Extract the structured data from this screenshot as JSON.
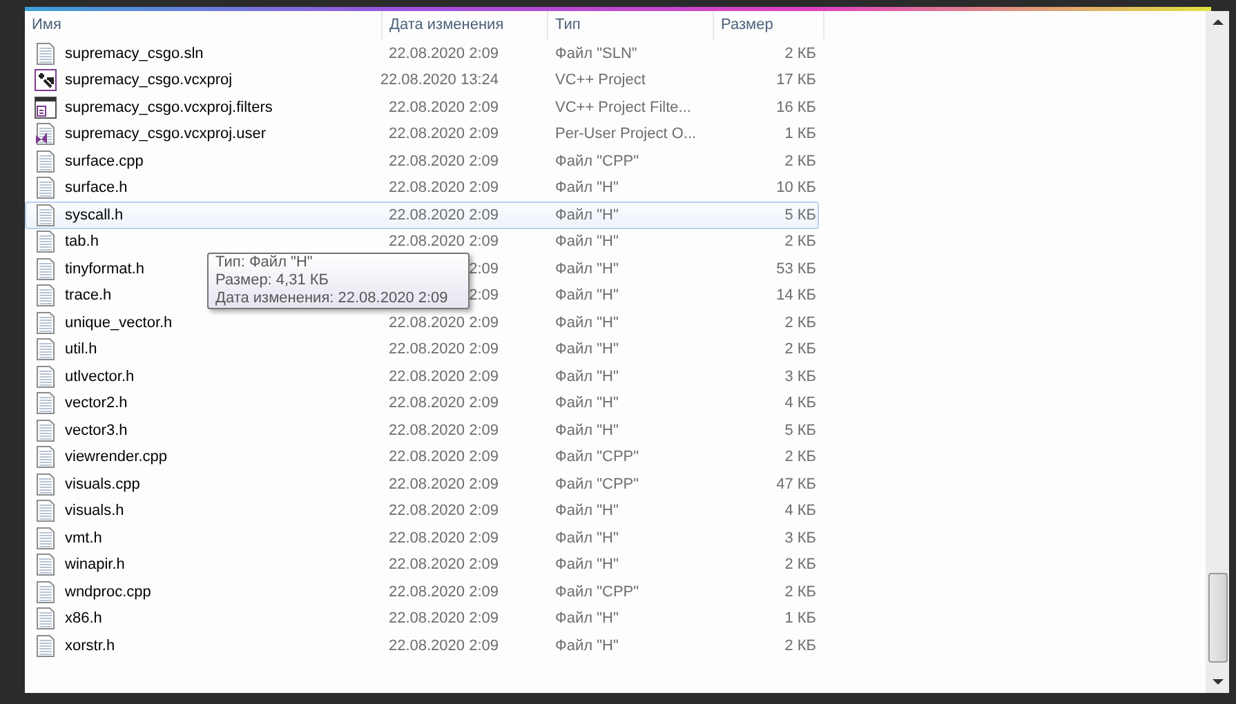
{
  "columns": [
    "Имя",
    "Дата изменения",
    "Тип",
    "Размер"
  ],
  "rows": [
    {
      "kind": "generic",
      "name": "supremacy_csgo.sln",
      "date": "22.08.2020 2:09",
      "type": "Файл \"SLN\"",
      "size": "2 КБ",
      "selected": false
    },
    {
      "kind": "project",
      "name": "supremacy_csgo.vcxproj",
      "date": "22.08.2020 13:24",
      "type": "VC++ Project",
      "size": "17 КБ",
      "selected": false
    },
    {
      "kind": "filters",
      "name": "supremacy_csgo.vcxproj.filters",
      "date": "22.08.2020 2:09",
      "type": "VC++ Project Filte...",
      "size": "16 КБ",
      "selected": false
    },
    {
      "kind": "user",
      "name": "supremacy_csgo.vcxproj.user",
      "date": "22.08.2020 2:09",
      "type": "Per-User Project O...",
      "size": "1 КБ",
      "selected": false
    },
    {
      "kind": "text",
      "name": "surface.cpp",
      "date": "22.08.2020 2:09",
      "type": "Файл \"CPP\"",
      "size": "2 КБ",
      "selected": false
    },
    {
      "kind": "text",
      "name": "surface.h",
      "date": "22.08.2020 2:09",
      "type": "Файл \"H\"",
      "size": "10 КБ",
      "selected": false
    },
    {
      "kind": "text",
      "name": "syscall.h",
      "date": "22.08.2020 2:09",
      "type": "Файл \"H\"",
      "size": "5 КБ",
      "selected": true
    },
    {
      "kind": "text",
      "name": "tab.h",
      "date": "22.08.2020 2:09",
      "type": "Файл \"H\"",
      "size": "2 КБ",
      "selected": false
    },
    {
      "kind": "text",
      "name": "tinyformat.h",
      "date": "2:09",
      "type": "Файл \"H\"",
      "size": "53 КБ",
      "selected": false
    },
    {
      "kind": "text",
      "name": "trace.h",
      "date": "2:09",
      "type": "Файл \"H\"",
      "size": "14 КБ",
      "selected": false
    },
    {
      "kind": "text",
      "name": "unique_vector.h",
      "date": "22.08.2020 2:09",
      "type": "Файл \"H\"",
      "size": "2 КБ",
      "selected": false
    },
    {
      "kind": "text",
      "name": "util.h",
      "date": "22.08.2020 2:09",
      "type": "Файл \"H\"",
      "size": "2 КБ",
      "selected": false
    },
    {
      "kind": "text",
      "name": "utlvector.h",
      "date": "22.08.2020 2:09",
      "type": "Файл \"H\"",
      "size": "3 КБ",
      "selected": false
    },
    {
      "kind": "text",
      "name": "vector2.h",
      "date": "22.08.2020 2:09",
      "type": "Файл \"H\"",
      "size": "4 КБ",
      "selected": false
    },
    {
      "kind": "text",
      "name": "vector3.h",
      "date": "22.08.2020 2:09",
      "type": "Файл \"H\"",
      "size": "5 КБ",
      "selected": false
    },
    {
      "kind": "text",
      "name": "viewrender.cpp",
      "date": "22.08.2020 2:09",
      "type": "Файл \"CPP\"",
      "size": "2 КБ",
      "selected": false
    },
    {
      "kind": "text",
      "name": "visuals.cpp",
      "date": "22.08.2020 2:09",
      "type": "Файл \"CPP\"",
      "size": "47 КБ",
      "selected": false
    },
    {
      "kind": "text",
      "name": "visuals.h",
      "date": "22.08.2020 2:09",
      "type": "Файл \"H\"",
      "size": "4 КБ",
      "selected": false
    },
    {
      "kind": "text",
      "name": "vmt.h",
      "date": "22.08.2020 2:09",
      "type": "Файл \"H\"",
      "size": "3 КБ",
      "selected": false
    },
    {
      "kind": "text",
      "name": "winapir.h",
      "date": "22.08.2020 2:09",
      "type": "Файл \"H\"",
      "size": "2 КБ",
      "selected": false
    },
    {
      "kind": "text",
      "name": "wndproc.cpp",
      "date": "22.08.2020 2:09",
      "type": "Файл \"CPP\"",
      "size": "2 КБ",
      "selected": false
    },
    {
      "kind": "text",
      "name": "x86.h",
      "date": "22.08.2020 2:09",
      "type": "Файл \"H\"",
      "size": "1 КБ",
      "selected": false
    },
    {
      "kind": "text",
      "name": "xorstr.h",
      "date": "22.08.2020 2:09",
      "type": "Файл \"H\"",
      "size": "2 КБ",
      "selected": false
    }
  ],
  "tooltip": [
    "Тип: Файл \"H\"",
    "Размер: 4,31 КБ",
    "Дата изменения: 22.08.2020 2:09"
  ]
}
